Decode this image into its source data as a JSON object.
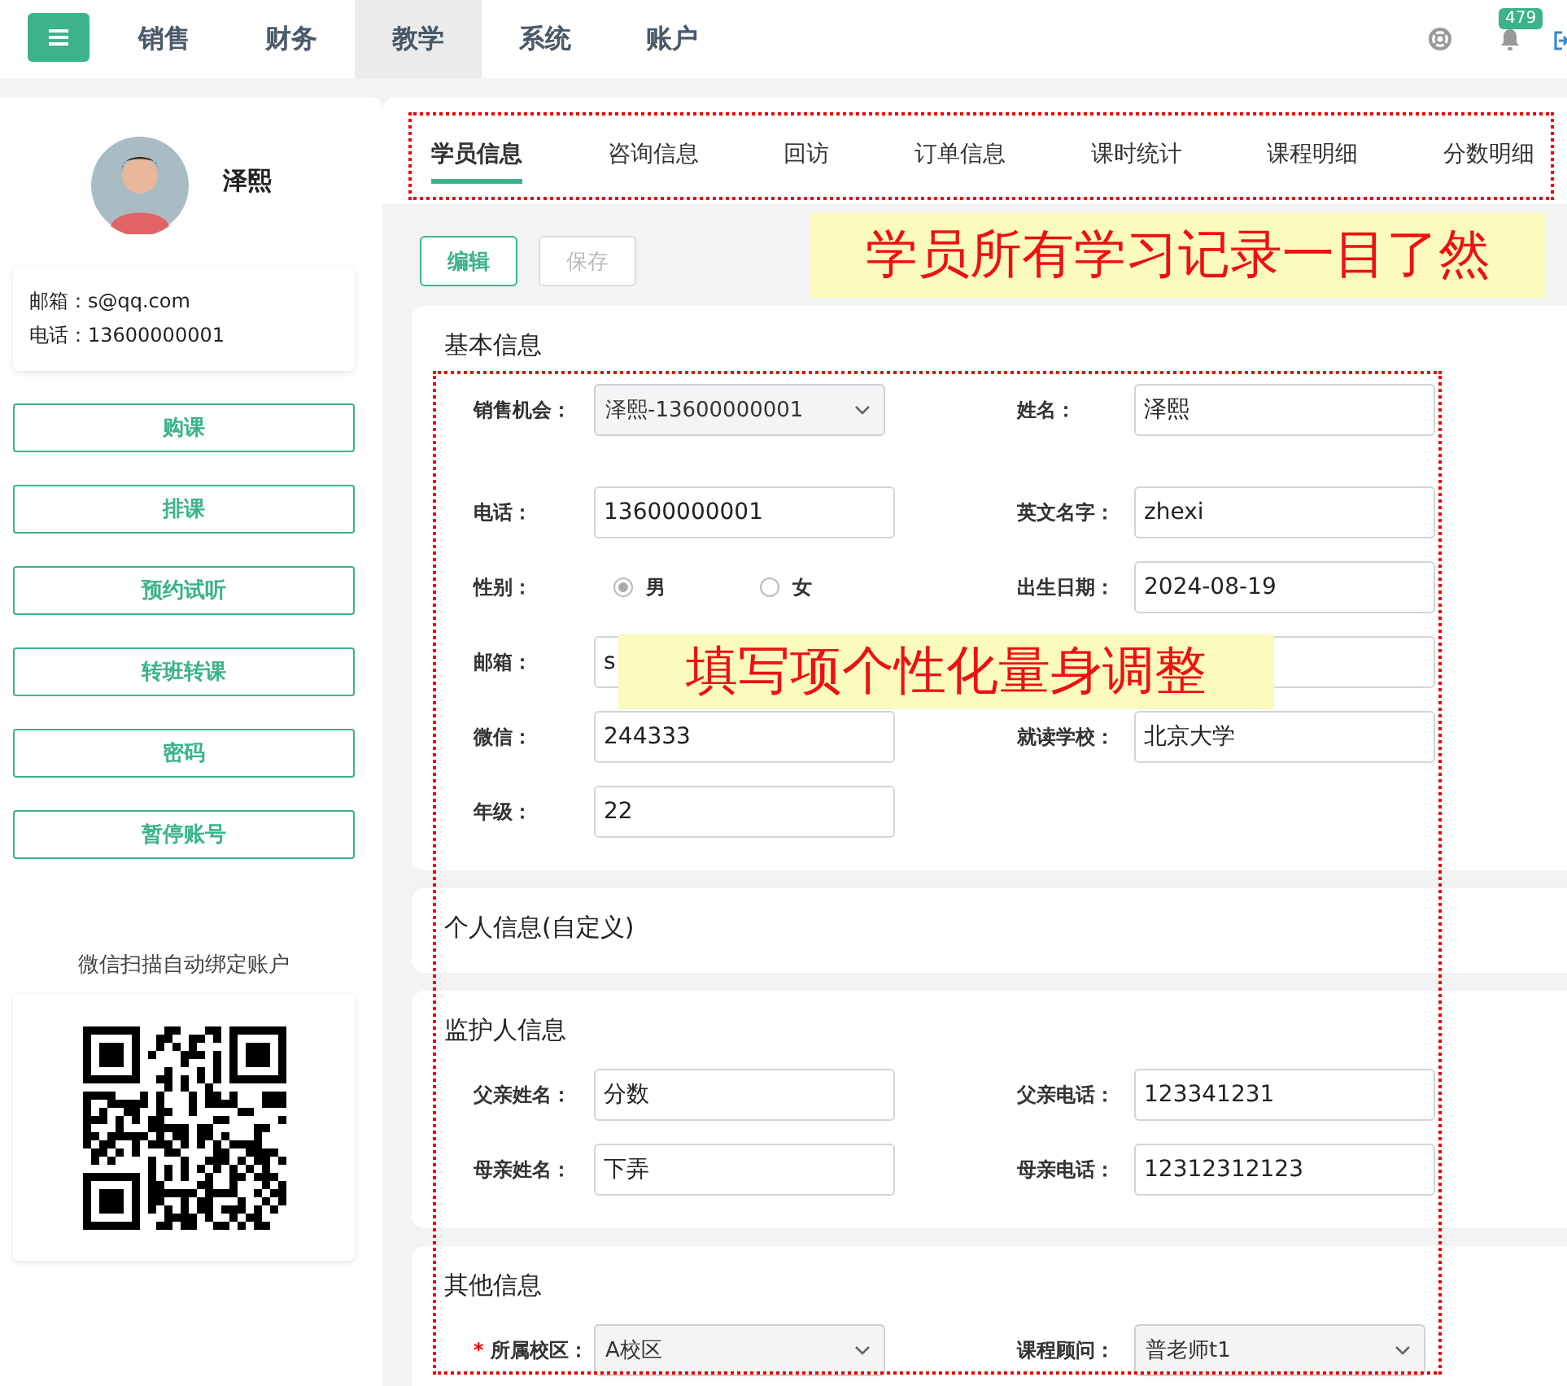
{
  "top_nav": {
    "items": [
      {
        "label": "销售",
        "selected": false
      },
      {
        "label": "财务",
        "selected": false
      },
      {
        "label": "教学",
        "selected": true
      },
      {
        "label": "系统",
        "selected": false
      },
      {
        "label": "账户",
        "selected": false
      }
    ],
    "notification_count": "479"
  },
  "profile": {
    "name": "泽熙",
    "email_label": "邮箱：",
    "email": "s@qq.com",
    "phone_label": "电话：",
    "phone": "13600000001",
    "actions": [
      "购课",
      "排课",
      "预约试听",
      "转班转课",
      "密码",
      "暂停账号"
    ],
    "qr_caption": "微信扫描自动绑定账户"
  },
  "tabs": {
    "outlined": true,
    "items": [
      {
        "label": "学员信息",
        "selected": true
      },
      {
        "label": "咨询信息",
        "selected": false
      },
      {
        "label": "回访",
        "selected": false
      },
      {
        "label": "订单信息",
        "selected": false
      },
      {
        "label": "课时统计",
        "selected": false
      },
      {
        "label": "课程明细",
        "selected": false
      },
      {
        "label": "分数明细",
        "selected": false
      }
    ]
  },
  "toolbar": [
    {
      "label": "编辑",
      "disabled": false
    },
    {
      "label": "保存",
      "disabled": true
    }
  ],
  "form_outlined": true,
  "sections": [
    {
      "title": "基本信息",
      "rows": [
        [
          {
            "kind": "select",
            "label": "销售机会：",
            "value": "泽熙-13600000001"
          },
          {
            "kind": "text",
            "label": "姓名：",
            "value": "泽熙"
          }
        ],
        [
          {
            "kind": "text",
            "label": "电话：",
            "value": "13600000001"
          },
          {
            "kind": "text",
            "label": "英文名字：",
            "value": "zhexi"
          }
        ],
        [
          {
            "kind": "radio",
            "label": "性别：",
            "options": [
              {
                "label": "男",
                "selected": true
              },
              {
                "label": "女",
                "selected": false
              }
            ]
          },
          {
            "kind": "text",
            "label": "出生日期：",
            "value": "2024-08-19"
          }
        ],
        [
          {
            "kind": "text",
            "label": "邮箱：",
            "value": "s"
          },
          {
            "kind": "text"
          }
        ],
        [
          {
            "kind": "text",
            "label": "微信：",
            "value": "244333"
          },
          {
            "kind": "text",
            "label": "就读学校：",
            "value": "北京大学"
          }
        ],
        [
          {
            "kind": "text",
            "label": "年级：",
            "value": "22"
          }
        ]
      ]
    },
    {
      "title": "个人信息(自定义)"
    },
    {
      "title": "监护人信息",
      "rows": [
        [
          {
            "kind": "text",
            "label": "父亲姓名：",
            "value": "分数"
          },
          {
            "kind": "text",
            "label": "父亲电话：",
            "value": "123341231"
          }
        ],
        [
          {
            "kind": "text",
            "label": "母亲姓名：",
            "value": "下弄"
          },
          {
            "kind": "text",
            "label": "母亲电话：",
            "value": "12312312123"
          }
        ]
      ]
    },
    {
      "title": "其他信息",
      "rows": [
        [
          {
            "kind": "select",
            "label": "所属校区：",
            "required_mark": "*",
            "value": "A校区"
          },
          {
            "kind": "select",
            "label": "课程顾问：",
            "value": "普老师t1"
          }
        ]
      ]
    }
  ],
  "callouts": [
    {
      "text": "学员所有学习记录一目了然"
    },
    {
      "text": "填写项个性化量身调整"
    }
  ]
}
